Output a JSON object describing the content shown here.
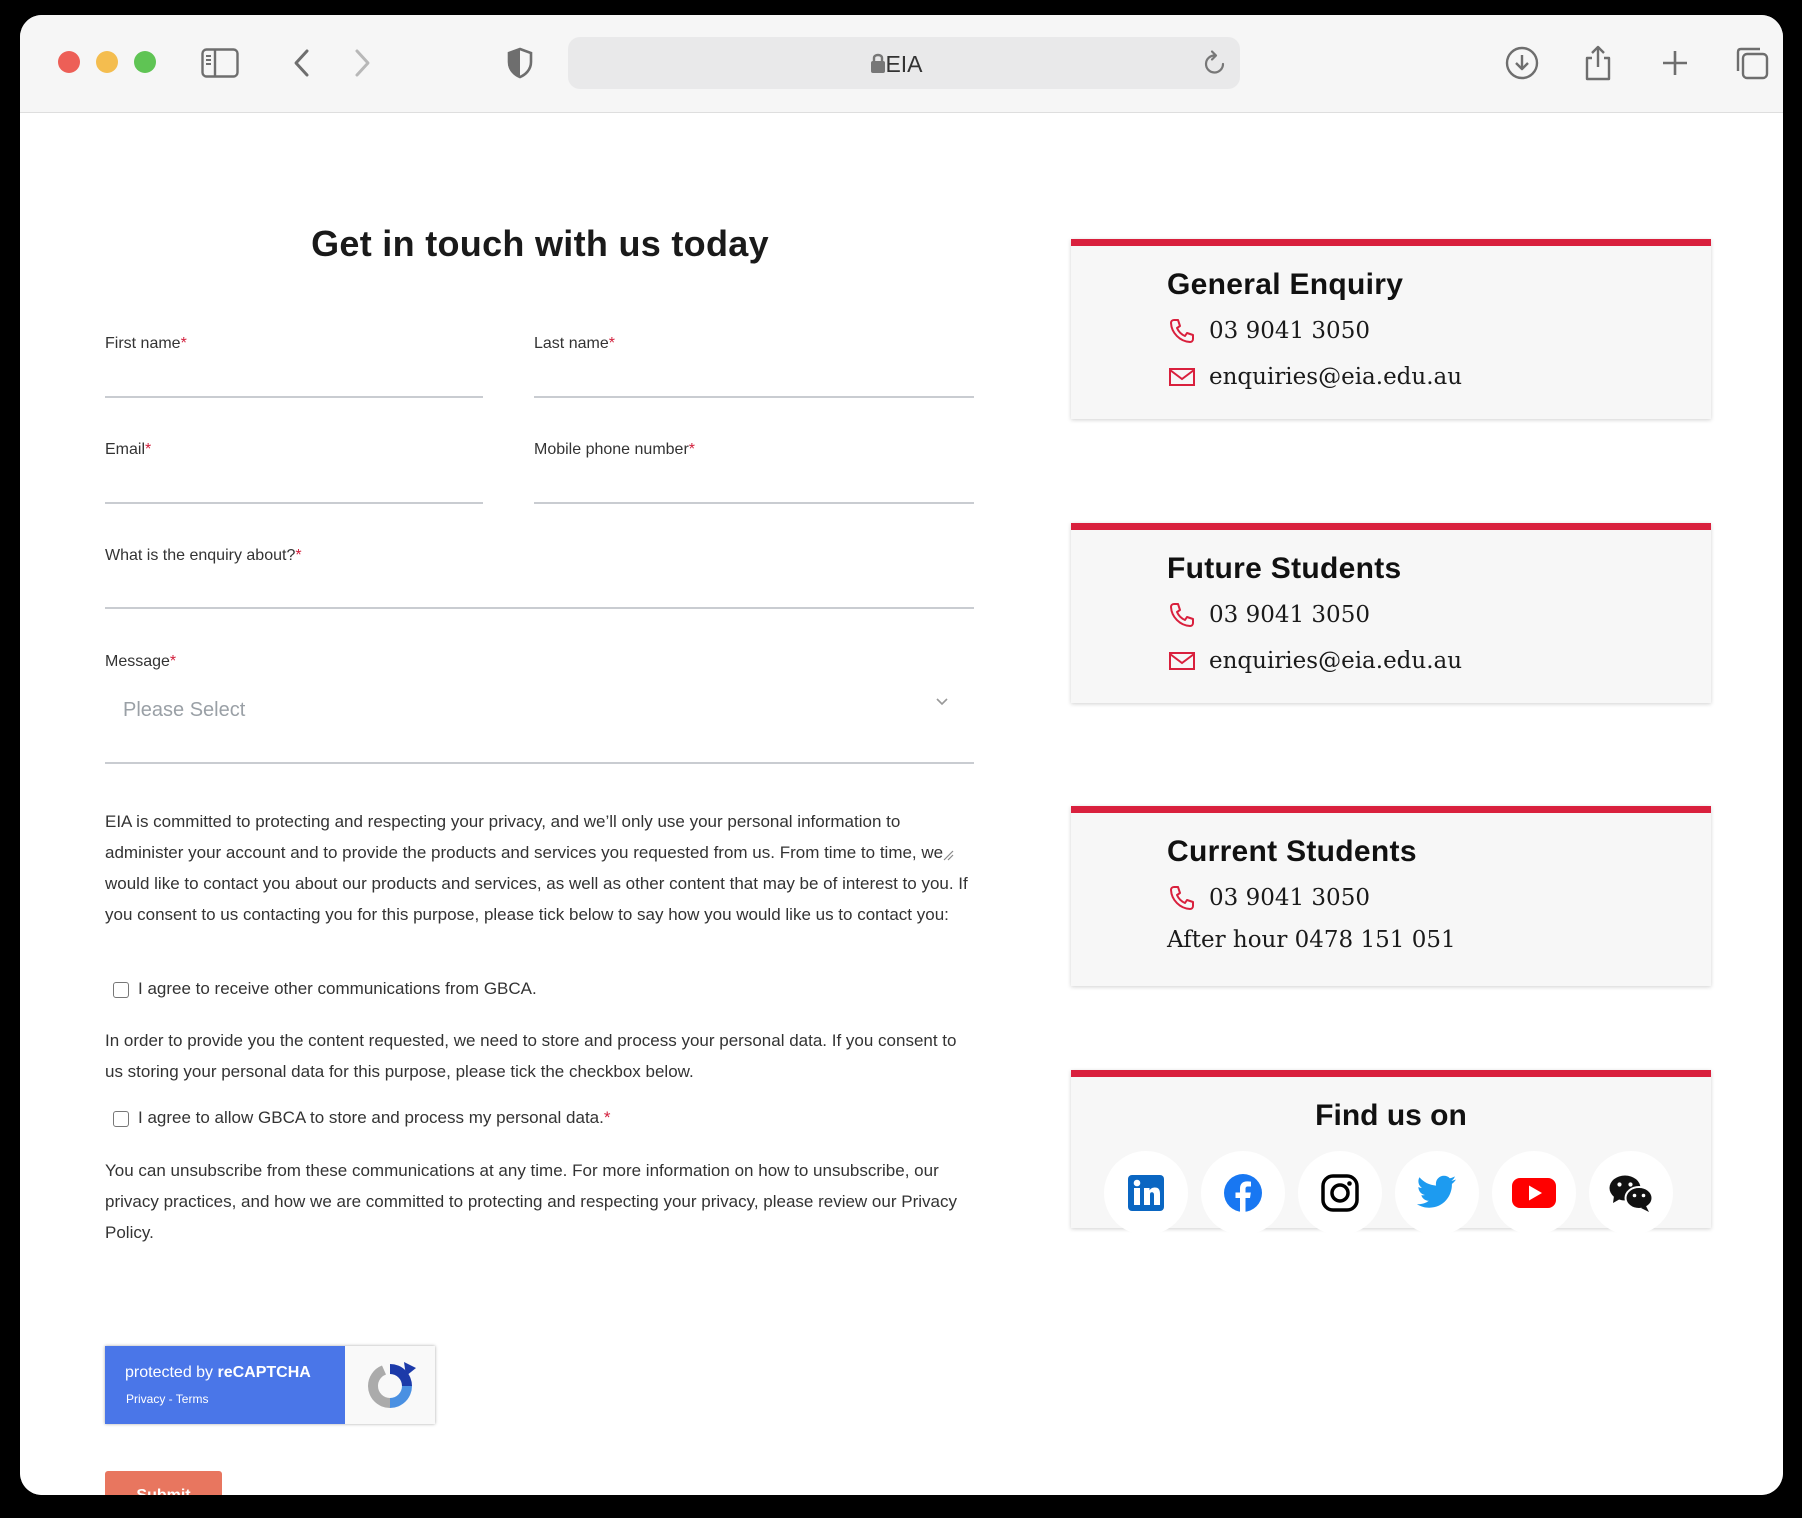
{
  "browser": {
    "url_display": "EIA"
  },
  "form": {
    "title": "Get in touch with us today",
    "first_name_label": "First name",
    "last_name_label": "Last name",
    "email_label": "Email",
    "mobile_label": "Mobile phone number",
    "enquiry_label": "What is the enquiry about?",
    "enquiry_placeholder": "Please Select",
    "message_label": "Message",
    "required_mark": "*",
    "privacy_text": "EIA is committed to protecting and respecting your privacy, and we’ll only use your personal information to administer your account and to provide the products and services you requested from us. From time to time, we would like to contact you about our products and services, as well as other content that may be of interest to you. If you consent to us contacting you for this purpose, please tick below to say how you would like us to contact you:",
    "consent_comms_label": "I agree to receive other communications from GBCA.",
    "storage_text": "In order to provide you the content requested, we need to store and process your personal data. If you consent to us storing your personal data for this purpose, please tick the checkbox below.",
    "consent_storage_label": "I agree to allow GBCA to store and process my personal data.",
    "unsubscribe_text": "You can unsubscribe from these communications at any time. For more information on how to unsubscribe, our privacy practices, and how we are committed to protecting and respecting your privacy, please review our Privacy Policy.",
    "recaptcha_line1_prefix": "protected by ",
    "recaptcha_line1_brand": "reCAPTCHA",
    "recaptcha_line2": "Privacy - Terms",
    "submit_label": "Submit"
  },
  "cards": {
    "general": {
      "title": "General Enquiry",
      "phone": "03 9041 3050",
      "email": "enquiries@eia.edu.au"
    },
    "future": {
      "title": "Future Students",
      "phone": "03 9041 3050",
      "email": "enquiries@eia.edu.au"
    },
    "current": {
      "title": "Current Students",
      "phone": "03 9041 3050",
      "after_hours": "After hour 0478 151 051"
    },
    "find": {
      "title": "Find us on"
    }
  },
  "colors": {
    "accent_red": "#d9203d",
    "submit_orange": "#e8765f",
    "recaptcha_blue": "#4a76e8"
  },
  "icons": {
    "social": [
      "linkedin-icon",
      "facebook-icon",
      "instagram-icon",
      "twitter-icon",
      "youtube-icon",
      "wechat-icon"
    ]
  }
}
